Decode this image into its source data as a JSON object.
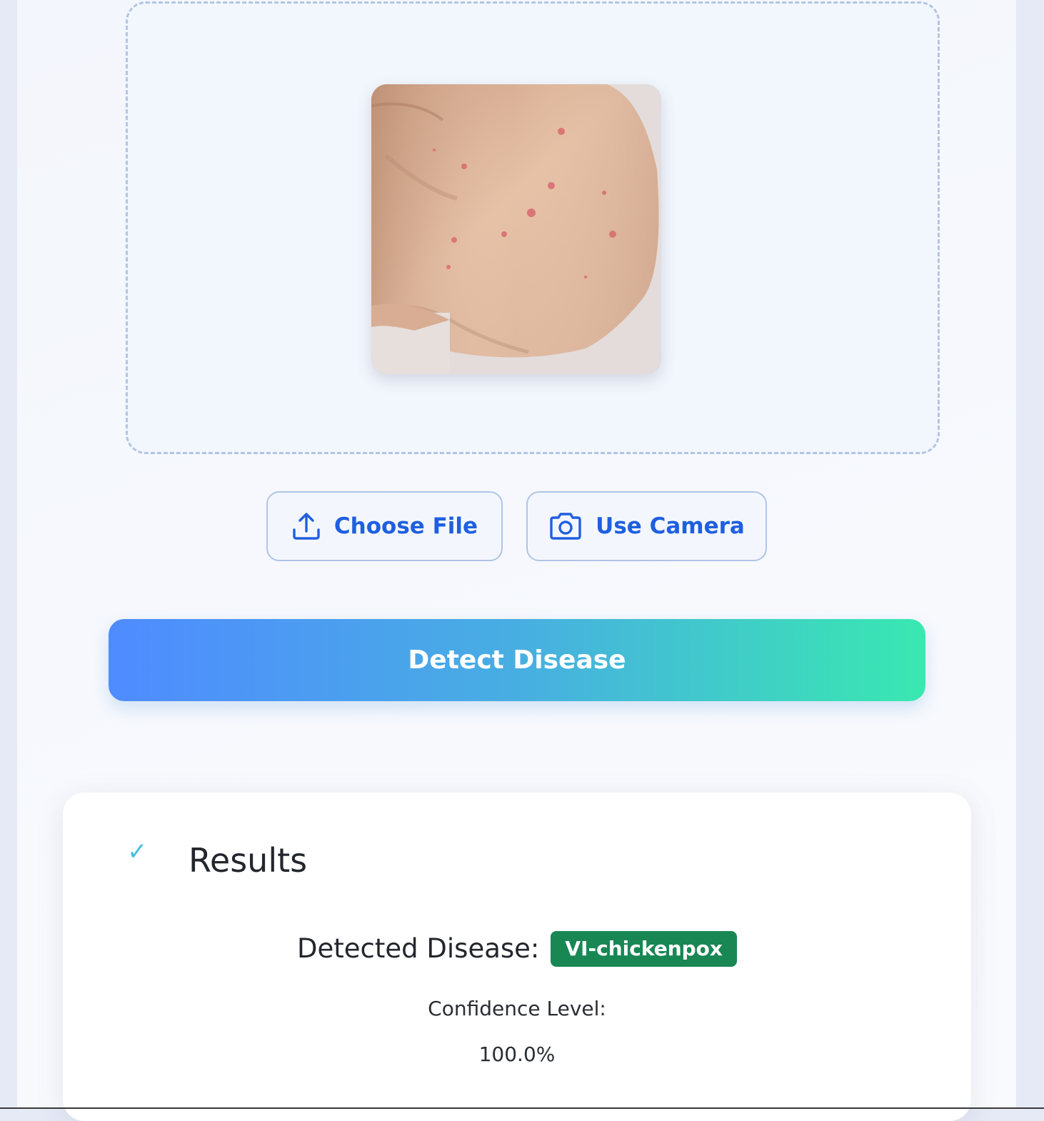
{
  "upload": {
    "choose_file_label": "Choose File",
    "use_camera_label": "Use Camera"
  },
  "actions": {
    "detect_label": "Detect Disease"
  },
  "results": {
    "title": "Results",
    "check_glyph": "✓",
    "detected_label": "Detected Disease:",
    "disease": "VI-chickenpox",
    "confidence_label": "Confidence Level:",
    "confidence_value": "100.0%"
  },
  "colors": {
    "accent": "#1f5fe0",
    "badge": "#198754",
    "gradient_start": "#4f8bff",
    "gradient_end": "#39e8b0"
  }
}
